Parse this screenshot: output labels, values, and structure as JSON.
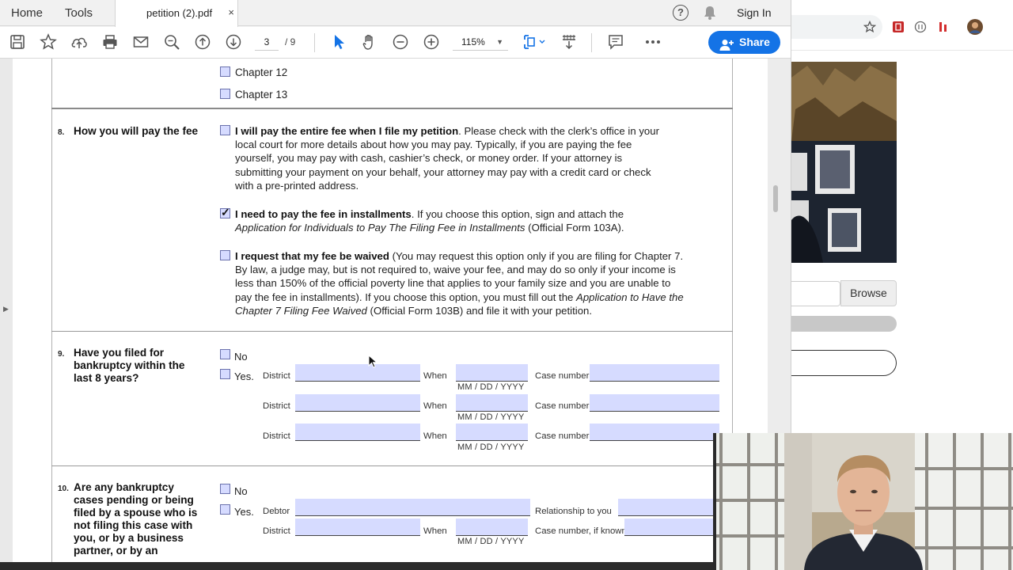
{
  "acrobat": {
    "tabs": {
      "home": "Home",
      "tools": "Tools",
      "document": "petition (2).pdf",
      "close": "×"
    },
    "header": {
      "signin": "Sign In"
    },
    "toolbar": {
      "page_current": "3",
      "page_total": "/ 9",
      "zoom": "115%",
      "share": "Share",
      "icons": [
        "save-icon",
        "bookmark-star-icon",
        "upload-icon",
        "print-icon",
        "email-icon",
        "zoom-search-icon",
        "page-up-icon",
        "page-down-icon",
        "select-cursor-icon",
        "hand-icon",
        "zoom-out-icon",
        "zoom-in-icon",
        "fit-page-icon",
        "scroll-mode-icon",
        "comment-icon",
        "more-icon"
      ]
    },
    "accent_color": "#1473e6"
  },
  "document": {
    "chapter_options": [
      {
        "label": "Chapter 12",
        "checked": false
      },
      {
        "label": "Chapter 13",
        "checked": false
      }
    ],
    "q8": {
      "number": "8.",
      "question": "How you will pay the fee",
      "options": [
        {
          "bold": "I will pay the entire fee when I file my petition",
          "lines": [
            ". Please check with the clerk’s office in your",
            "local court for more details about how you may pay. Typically, if you are paying the fee",
            "yourself, you may pay with cash, cashier’s check, or money order. If your attorney is",
            "submitting your payment on your behalf, your attorney may pay with a credit card or check",
            "with a pre-printed address."
          ],
          "checked": false
        },
        {
          "bold": "I need to pay the fee in installments",
          "line1_rest": ". If you choose this option, sign and attach the",
          "italic": "Application for Individuals to Pay The Filing Fee in Installments",
          "line2_rest": " (Official Form 103A).",
          "checked": true
        },
        {
          "bold": "I request that my fee be waived",
          "line1_rest": " (You may request this option only if you are filing for Chapter 7.",
          "lines": [
            "By law, a judge may, but is not required to, waive your fee, and may do so only if your income is",
            "less than 150% of the official poverty line that applies to your family size and you are unable to"
          ],
          "line4_pre": "pay the fee in installments). If you choose this option, you must fill out the ",
          "line4_italic": "Application to Have the",
          "line5_italic": "Chapter 7 Filing Fee Waived",
          "line5_rest": " (Official Form 103B) and file it with your petition.",
          "checked": false
        }
      ]
    },
    "q9": {
      "number": "9.",
      "question_lines": [
        "Have you filed for",
        "bankruptcy within the",
        "last 8 years?"
      ],
      "no": "No",
      "yes": "Yes.",
      "row_labels": {
        "district": "District",
        "when": "When",
        "case_number": "Case number",
        "date_hint": "MM /  DD / YYYY"
      }
    },
    "q10": {
      "number": "10.",
      "question_lines": [
        "Are any bankruptcy",
        "cases pending or being",
        "filed by a spouse who is",
        "not filing this case with",
        "you, or by a business",
        "partner, or by an"
      ],
      "no": "No",
      "yes": "Yes.",
      "labels": {
        "debtor": "Debtor",
        "relationship": "Relationship to you",
        "district": "District",
        "when": "When",
        "case_number_known": "Case number, if known",
        "date_hint": "MM / DD  / YYYY"
      }
    }
  },
  "browser": {
    "browse_button": "Browse",
    "toolbar_icons": [
      "bookmark-star-icon",
      "extension-red-icon",
      "extension-circle-icon",
      "extension-bars-icon",
      "profile-avatar-icon"
    ]
  },
  "webcam": {
    "label": "presenter-webcam-feed"
  }
}
